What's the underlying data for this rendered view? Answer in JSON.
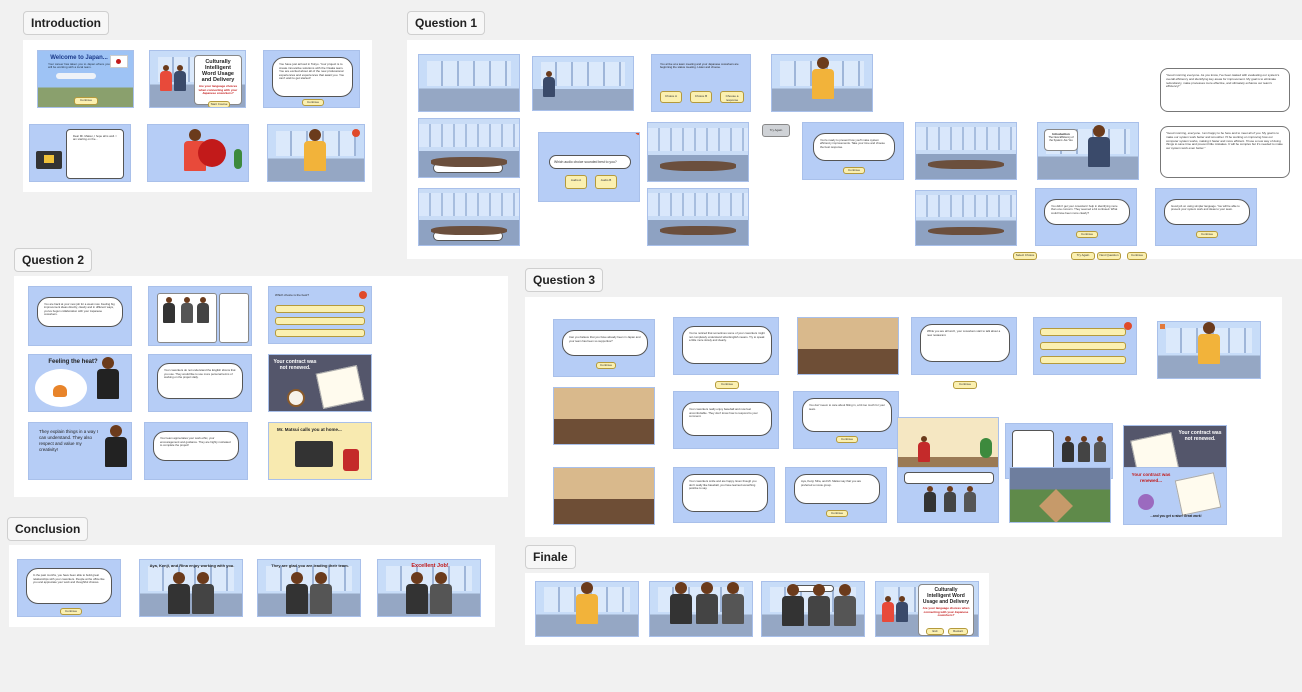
{
  "sections": {
    "intro": "Introduction",
    "q1": "Question 1",
    "q2": "Question 2",
    "q3": "Question 3",
    "conclusion": "Conclusion",
    "finale": "Finale"
  },
  "slides": {
    "welcome_title": "Welcome to Japan...",
    "welcome_sub": "Your career has taken you to Japan where you will be working with a local team.",
    "btn_continue": "Continue",
    "title_main": "Culturally Intelligent Word Usage and Delivery",
    "title_sub": "Are your language choices when connecting with your Japanese coworkers?",
    "btn_start": "Start Course",
    "intro_text": "You have just arrived in Tokyo. Your project is to create innovative solutions with the Osaka team. You are excited about all of the new professional experiences and experiences that await you. You can't wait to get started!",
    "email_text": "Dear Mr. Matsui, I hope all is well. I am starting on the...",
    "q1_prompt": "Which audio choice sounded best to you?",
    "q1_opt_a": "Audio A",
    "q1_opt_b": "Audio B",
    "q1_opt_a2": "Choice A",
    "q1_opt_b2": "Choice B",
    "q1_gray": "Try Again",
    "q1_choose": "Choose a response",
    "q1_text1": "You arrive at a team meeting and your Japanese coworkers are beginning the status meeting. Listen and choose.",
    "q1_text2": "You're ready to present how you'll make system efficiency improvements. Take your time and choose the best response.",
    "q1_note1": "\"Good morning everyone. As you know, I've been tasked with evaluating our system's overall efficiency and identifying key areas for improvement. My goal is to eliminate redundancy, make processes more effective, and ultimately enhance our team's efficiency!\"",
    "q1_note2": "\"Good morning, everyone. I am happy to be here and to meet all of you. My goal is to make our system work better and smoother. I'll be working on improving how our computer system works, making it faster and more efficient. I'll use a new way of doing things to save time and prevent little mistakes. It will be complex but it's needed to make our system work even better.\"",
    "q1_intro_label": "Introduction",
    "q1_intro_sub": "The New Efficiency of the System: Are You",
    "q1_bottom_text": "You didn't get your coworkers' help in identifying more than one concern. They seemed a bit confused. What could have been more clearly?",
    "q1_chip1": "Select Choice",
    "q1_chip2": "Try Again",
    "q1_chip3": "Next Question",
    "q1_chip4": "Continue",
    "q1_final_text": "Good job on using simpler language. You will be able to present your system work and ideas to your team.",
    "q1_final_btn": "Continue",
    "q2_text1": "You are back at your new job for a week now. Feeling big improvement ideas directly, clearly and in different ways, you've begun collaboration with your Japanese coworkers.",
    "q2_feeling": "Feeling the heat?",
    "q2_text2": "Your coworkers do not understand the English idioms that you use. They would like to use more personal terms of working on the project daily.",
    "q2_contract": "Your contract was not renewed.",
    "q2_explain": "They explain things in a way I can understand. They also respect and value my creativity!",
    "q2_text3": "Your team appreciates your work ethic, your encouragement and guidance. They are highly motivated to complete the project!",
    "q2_matsui": "Mr. Matsui calls you at home...",
    "q2_choice1": "Which choice is the best?",
    "q3_text1": "Can you believe that you have already been in Japan and your team has been so supportive?",
    "q3_text2": "You've noticed that sometimes some of your coworkers might not completely understand what English means. Try to speak a little more slowly and clearly.",
    "q3_text3": "While you are all lunch, your coworkers start to talk about a new restaurant.",
    "q3_text4": "Your coworkers really enjoy baseball and now feel uncomfortable. They don't know how to respond to your comment.",
    "q3_text5": "You don't seem to care about fitting in, a bit too much for your team.",
    "q3_text6": "Your coworkers smile and are happy. Even though you don't really like baseball, you have learned something positive to say.",
    "q3_text7": "Aya, Kenji, Mira, and Mr. Matsui say that you are preferred a movie group.",
    "q3_contract": "Your contract was not renewed.",
    "q3_renewed": "Your contract was renewed...",
    "q3_renewed_sub": "...and you get a raise! Great work!",
    "concl_text": "In the past months, you have been able to build great relationships with your coworkers. People at the office like you and appreciate your work and thoughtful choices.",
    "concl_enjoy": "Aya, Kenji, and Rina enjoy working with you.",
    "concl_glad": "They are glad you are leading their team.",
    "concl_excellent": "Excellent Job!",
    "finale_title": "Culturally Intelligent Word Usage and Delivery",
    "finale_sub": "Are your language choices when connecting with your Japanese coworkers?",
    "finale_btn1": "Exit",
    "finale_btn2": "Restart"
  },
  "colors": {
    "slide_bg": "#b6cdf6",
    "accent_red": "#c21a1a",
    "button_yellow": "#fbf0b0"
  }
}
